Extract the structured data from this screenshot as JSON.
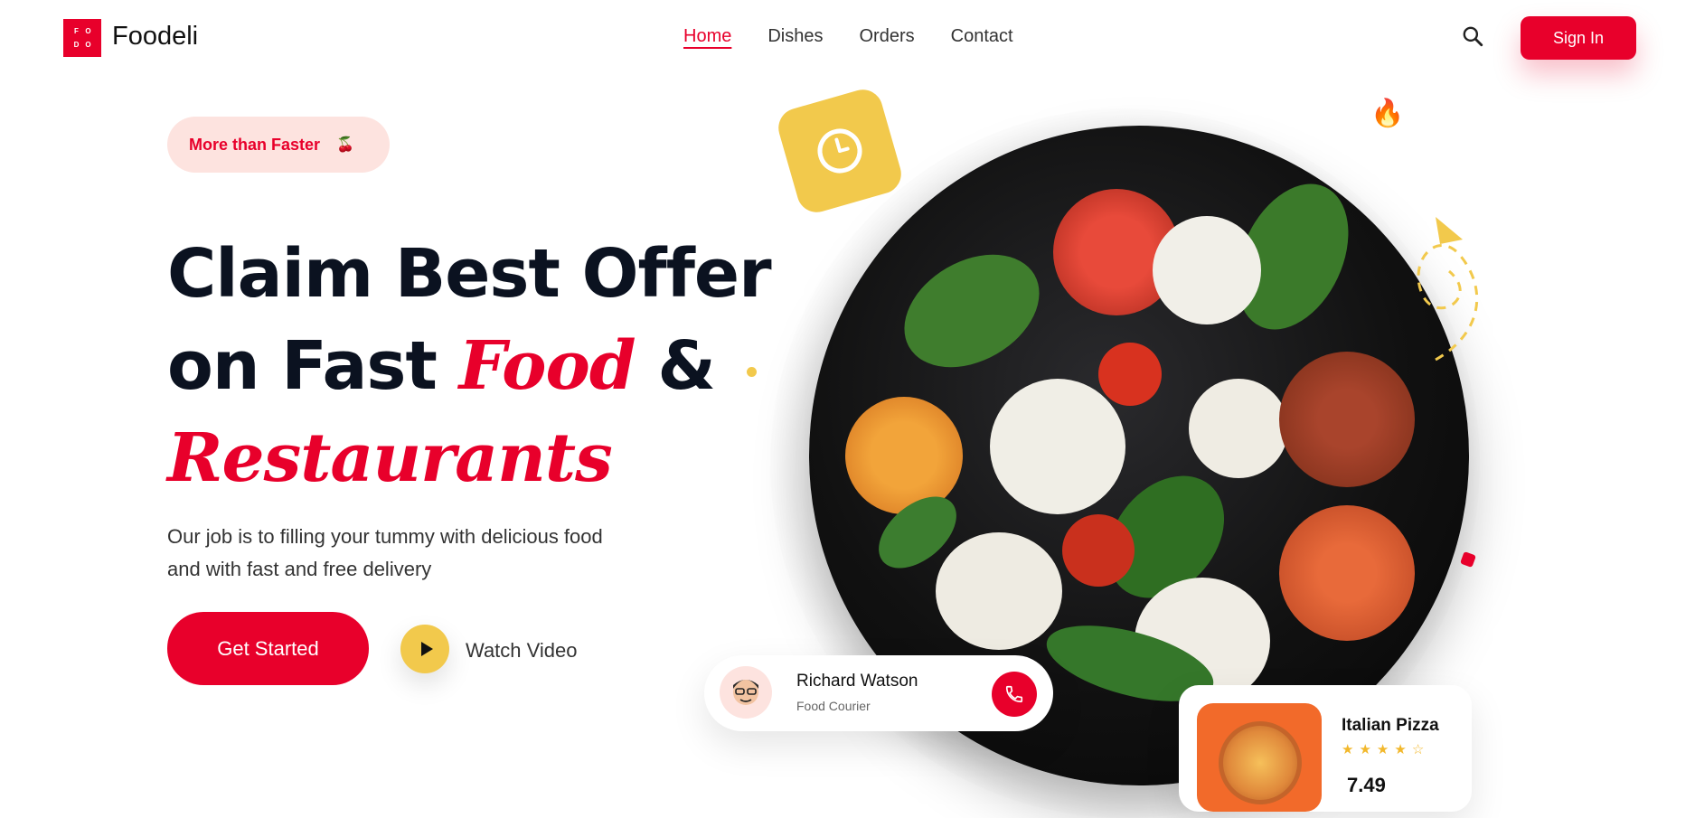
{
  "brand": {
    "logo_letters": [
      "F",
      "O",
      "D",
      "O"
    ],
    "name": "Foodeli"
  },
  "nav": {
    "items": [
      "Home",
      "Dishes",
      "Orders",
      "Contact"
    ],
    "active": "Home"
  },
  "header": {
    "signin_label": "Sign In"
  },
  "hero": {
    "pill_label": "More than Faster",
    "headline_line1": "Claim Best Offer",
    "headline_line2_pre": "on Fast ",
    "headline_line2_script": "Food",
    "headline_line2_post": " &",
    "headline_line3_script": "Restaurants",
    "subtitle_line1": "Our job is to filling your tummy with delicious food",
    "subtitle_line2": "and  with fast and free delivery",
    "cta_label": "Get Started",
    "watch_label": "Watch Video"
  },
  "courier": {
    "name": "Richard Watson",
    "role": "Food Courier"
  },
  "pizza": {
    "title": "Italian Pizza",
    "rating": 4.5,
    "price_partial": "7.49"
  },
  "colors": {
    "accent": "#e8002b",
    "yellow": "#f2c94c",
    "pill_bg": "#fde3df"
  },
  "icons": [
    "search-icon",
    "cherry-icon",
    "play-icon",
    "clock-icon",
    "fire-icon",
    "phone-icon",
    "star-icon"
  ]
}
